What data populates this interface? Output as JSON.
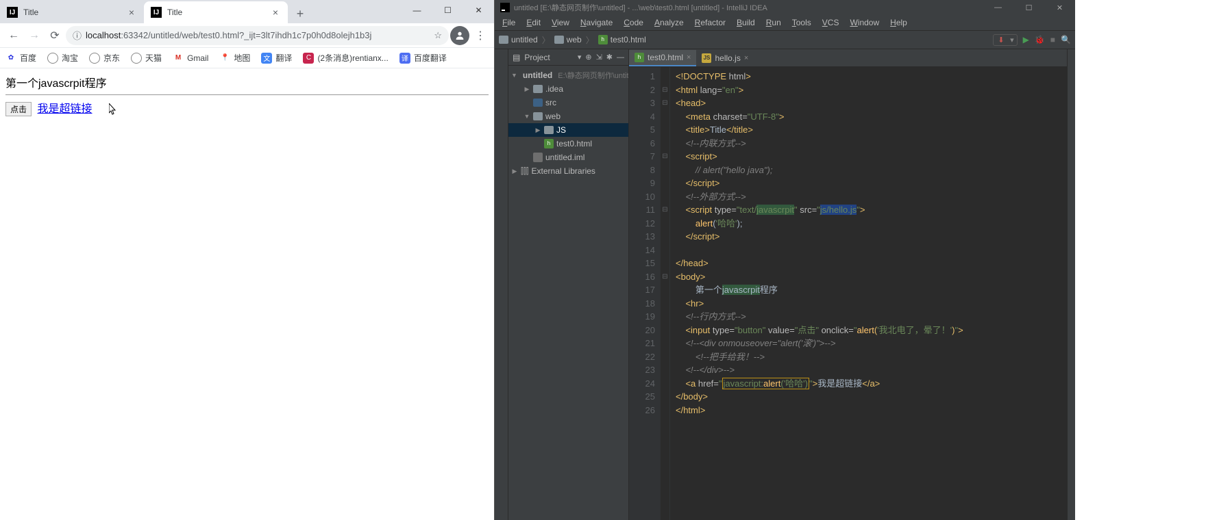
{
  "chrome": {
    "tabs": [
      {
        "title": "Title"
      },
      {
        "title": "Title"
      }
    ],
    "url_host": "localhost",
    "url_port_path": ":63342/untitled/web/test0.html?_ijt=3lt7ihdh1c7p0h0d8olejh1b3j",
    "bookmarks": [
      "百度",
      "淘宝",
      "京东",
      "天猫",
      "Gmail",
      "地图",
      "翻译",
      "(2条消息)rentianx...",
      "百度翻译"
    ],
    "page_heading": "第一个javascrpit程序",
    "button_value": "点击",
    "link_text": "我是超链接"
  },
  "ide": {
    "title": "untitled [E:\\静态网页制作\\untitled] - ...\\web\\test0.html [untitled] - IntelliJ IDEA",
    "menu": [
      "File",
      "Edit",
      "View",
      "Navigate",
      "Code",
      "Analyze",
      "Refactor",
      "Build",
      "Run",
      "Tools",
      "VCS",
      "Window",
      "Help"
    ],
    "breadcrumbs": [
      "untitled",
      "web",
      "test0.html"
    ],
    "run_label": "↓",
    "project_title": "Project",
    "tree": {
      "root": "untitled",
      "root_path": "E:\\静态网页制作\\untitle",
      "idea": ".idea",
      "src": "src",
      "web": "web",
      "js": "JS",
      "test0": "test0.html",
      "iml": "untitled.iml",
      "ext": "External Libraries"
    },
    "tabs": [
      {
        "name": "test0.html",
        "type": "html"
      },
      {
        "name": "hello.js",
        "type": "js"
      }
    ],
    "code_lines": [
      {
        "n": 1,
        "html": "<span class='tag'>&lt;!DOCTYPE <span class='attr'>html</span>&gt;</span>"
      },
      {
        "n": 2,
        "html": "<span class='tag'>&lt;html <span class='attr'>lang=</span><span class='str'>\"en\"</span>&gt;</span>"
      },
      {
        "n": 3,
        "html": "<span class='tag'>&lt;head&gt;</span>"
      },
      {
        "n": 4,
        "html": "    <span class='tag'>&lt;meta <span class='attr'>charset=</span><span class='str'>\"UTF-8\"</span>&gt;</span>"
      },
      {
        "n": 5,
        "html": "    <span class='tag'>&lt;title&gt;</span><span class='txt'>Title</span><span class='tag'>&lt;/title&gt;</span>"
      },
      {
        "n": 6,
        "html": "    <span class='cmt'>&lt;!--内联方式--&gt;</span>"
      },
      {
        "n": 7,
        "html": "    <span class='tag'>&lt;script&gt;</span>"
      },
      {
        "n": 8,
        "html": "        <span class='cmt'>// alert(\"hello java\");</span>"
      },
      {
        "n": 9,
        "html": "    <span class='tag'>&lt;/script&gt;</span>"
      },
      {
        "n": 10,
        "html": "    <span class='cmt'>&lt;!--外部方式--&gt;</span>"
      },
      {
        "n": 11,
        "html": "    <span class='tag'>&lt;script <span class='attr'>type=</span><span class='str'>\"text/<span class='hl'>javascrpit</span>\"</span> <span class='attr'>src=</span><span class='str'>\"<span class='hl2'>js/hello.js</span>\"</span>&gt;</span>"
      },
      {
        "n": 12,
        "html": "        <span class='fn'>alert</span>(<span class='str'>'哈哈'</span>);"
      },
      {
        "n": 13,
        "html": "    <span class='tag'>&lt;/script&gt;</span>"
      },
      {
        "n": 14,
        "html": ""
      },
      {
        "n": 15,
        "html": "<span class='tag'>&lt;/head&gt;</span>"
      },
      {
        "n": 16,
        "html": "<span class='tag'>&lt;body&gt;</span>"
      },
      {
        "n": 17,
        "html": "        <span class='txt'>第一个<span class='hl'>javascrpit</span>程序</span>"
      },
      {
        "n": 18,
        "html": "    <span class='tag'>&lt;hr&gt;</span>"
      },
      {
        "n": 19,
        "html": "    <span class='cmt'>&lt;!--行内方式--&gt;</span>"
      },
      {
        "n": 20,
        "html": "    <span class='tag'>&lt;input <span class='attr'>type=</span><span class='str'>\"button\"</span> <span class='attr'>value=</span><span class='str'>\"点击\"</span> <span class='attr'>onclick=</span><span class='str'>\"</span><span class='fn'>alert</span>(<span class='str'>'我北电了，晕了！'</span>)<span class='str'>\"</span>&gt;</span>"
      },
      {
        "n": 21,
        "html": "    <span class='cmt'>&lt;!--&lt;div onmouseover=\"alert('滚')\"&gt;--&gt;</span>"
      },
      {
        "n": 22,
        "html": "        <span class='cmt'>&lt;!--把手给我！--&gt;</span>"
      },
      {
        "n": 23,
        "html": "    <span class='cmt'>&lt;!--&lt;/div&gt;--&gt;</span>"
      },
      {
        "n": 24,
        "html": "    <span class='tag'>&lt;a <span class='attr'>href=</span><span class='str'>\"<span class='warning-box'>javascript:<span class='fn'>alert</span>(<span class='str'>'哈哈'</span>)</span>\"</span>&gt;</span><span class='txt'>我是超链接</span><span class='tag'>&lt;/a&gt;</span>"
      },
      {
        "n": 25,
        "html": "<span class='tag'>&lt;/body&gt;</span>"
      },
      {
        "n": 26,
        "html": "<span class='tag'>&lt;/html&gt;</span>"
      }
    ]
  }
}
